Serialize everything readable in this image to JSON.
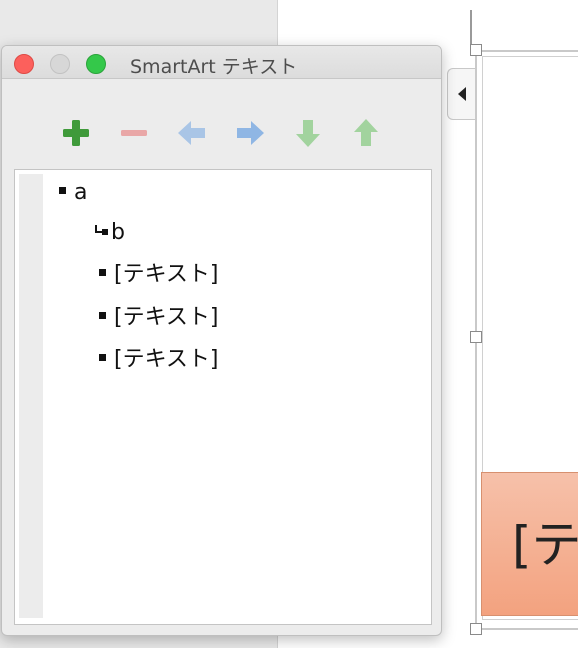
{
  "window": {
    "title": "SmartArt テキスト",
    "controls": [
      "close",
      "minimize",
      "zoom"
    ]
  },
  "toolbar": {
    "buttons": [
      {
        "icon": "plus-icon",
        "color": "#3f9a3a",
        "enabled": true
      },
      {
        "icon": "minus-icon",
        "color": "#e59c9c",
        "enabled": false
      },
      {
        "icon": "arrow-left-icon",
        "color": "#a8c4e4",
        "enabled": false
      },
      {
        "icon": "arrow-right-icon",
        "color": "#88b3e3",
        "enabled": true
      },
      {
        "icon": "arrow-down-icon",
        "color": "#9fd19b",
        "enabled": true
      },
      {
        "icon": "arrow-up-icon",
        "color": "#9fd19b",
        "enabled": true
      }
    ]
  },
  "outline": {
    "items": [
      {
        "text": "a",
        "level": 1
      },
      {
        "text": "b",
        "level": 2
      },
      {
        "text": "[テキスト]",
        "level": 1
      },
      {
        "text": "[テキスト]",
        "level": 1
      },
      {
        "text": "[テキスト]",
        "level": 1
      }
    ]
  },
  "canvas": {
    "shape_text": "[テ",
    "shape_color": "#f4a883"
  }
}
